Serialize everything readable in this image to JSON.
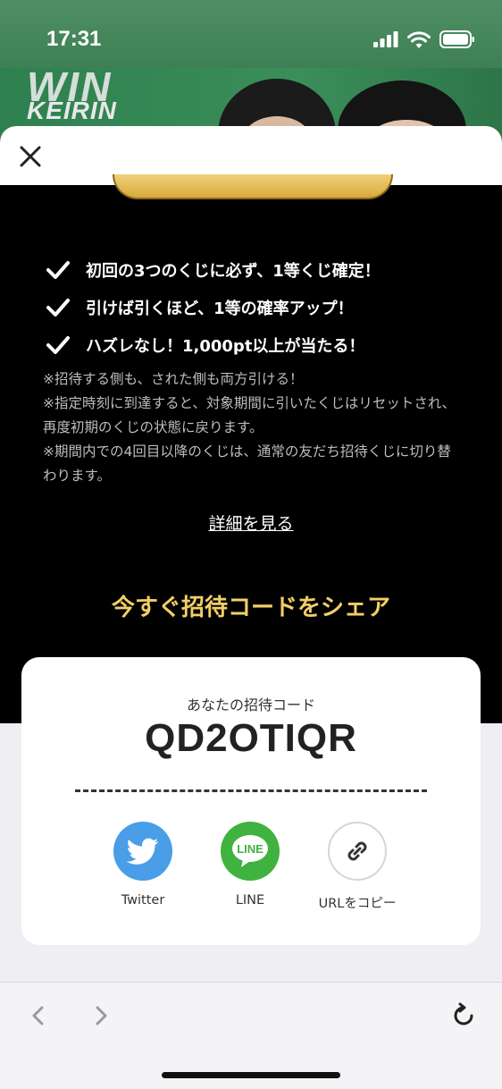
{
  "status_bar": {
    "time": "17:31"
  },
  "banner": {
    "logo_top": "WIN",
    "logo_bottom": "KEIRIN"
  },
  "benefits": [
    "初回の3つのくじに必ず、1等くじ確定！",
    "引けば引くほど、1等の確率アップ！",
    "ハズレなし！1,000pt以上が当たる！"
  ],
  "notes": [
    "※招待する側も、された側も両方引ける！",
    "※指定時刻に到達すると、対象期間に引いたくじはリセットされ、再度初期のくじの状態に戻ります。",
    "※期間内での4回目以降のくじは、通常の友だち招待くじに切り替わります。"
  ],
  "detail_link": "詳細を見る",
  "share_heading": "今すぐ招待コードをシェア",
  "invite": {
    "label": "あなたの招待コード",
    "code": "QD2OTIQR"
  },
  "share": {
    "twitter": "Twitter",
    "line": "LINE",
    "line_icon_text": "LINE",
    "copy": "URLをコピー"
  },
  "colors": {
    "accent_gold": "#f2cf66",
    "twitter_blue": "#4a9ee8",
    "line_green": "#3fb23f"
  }
}
